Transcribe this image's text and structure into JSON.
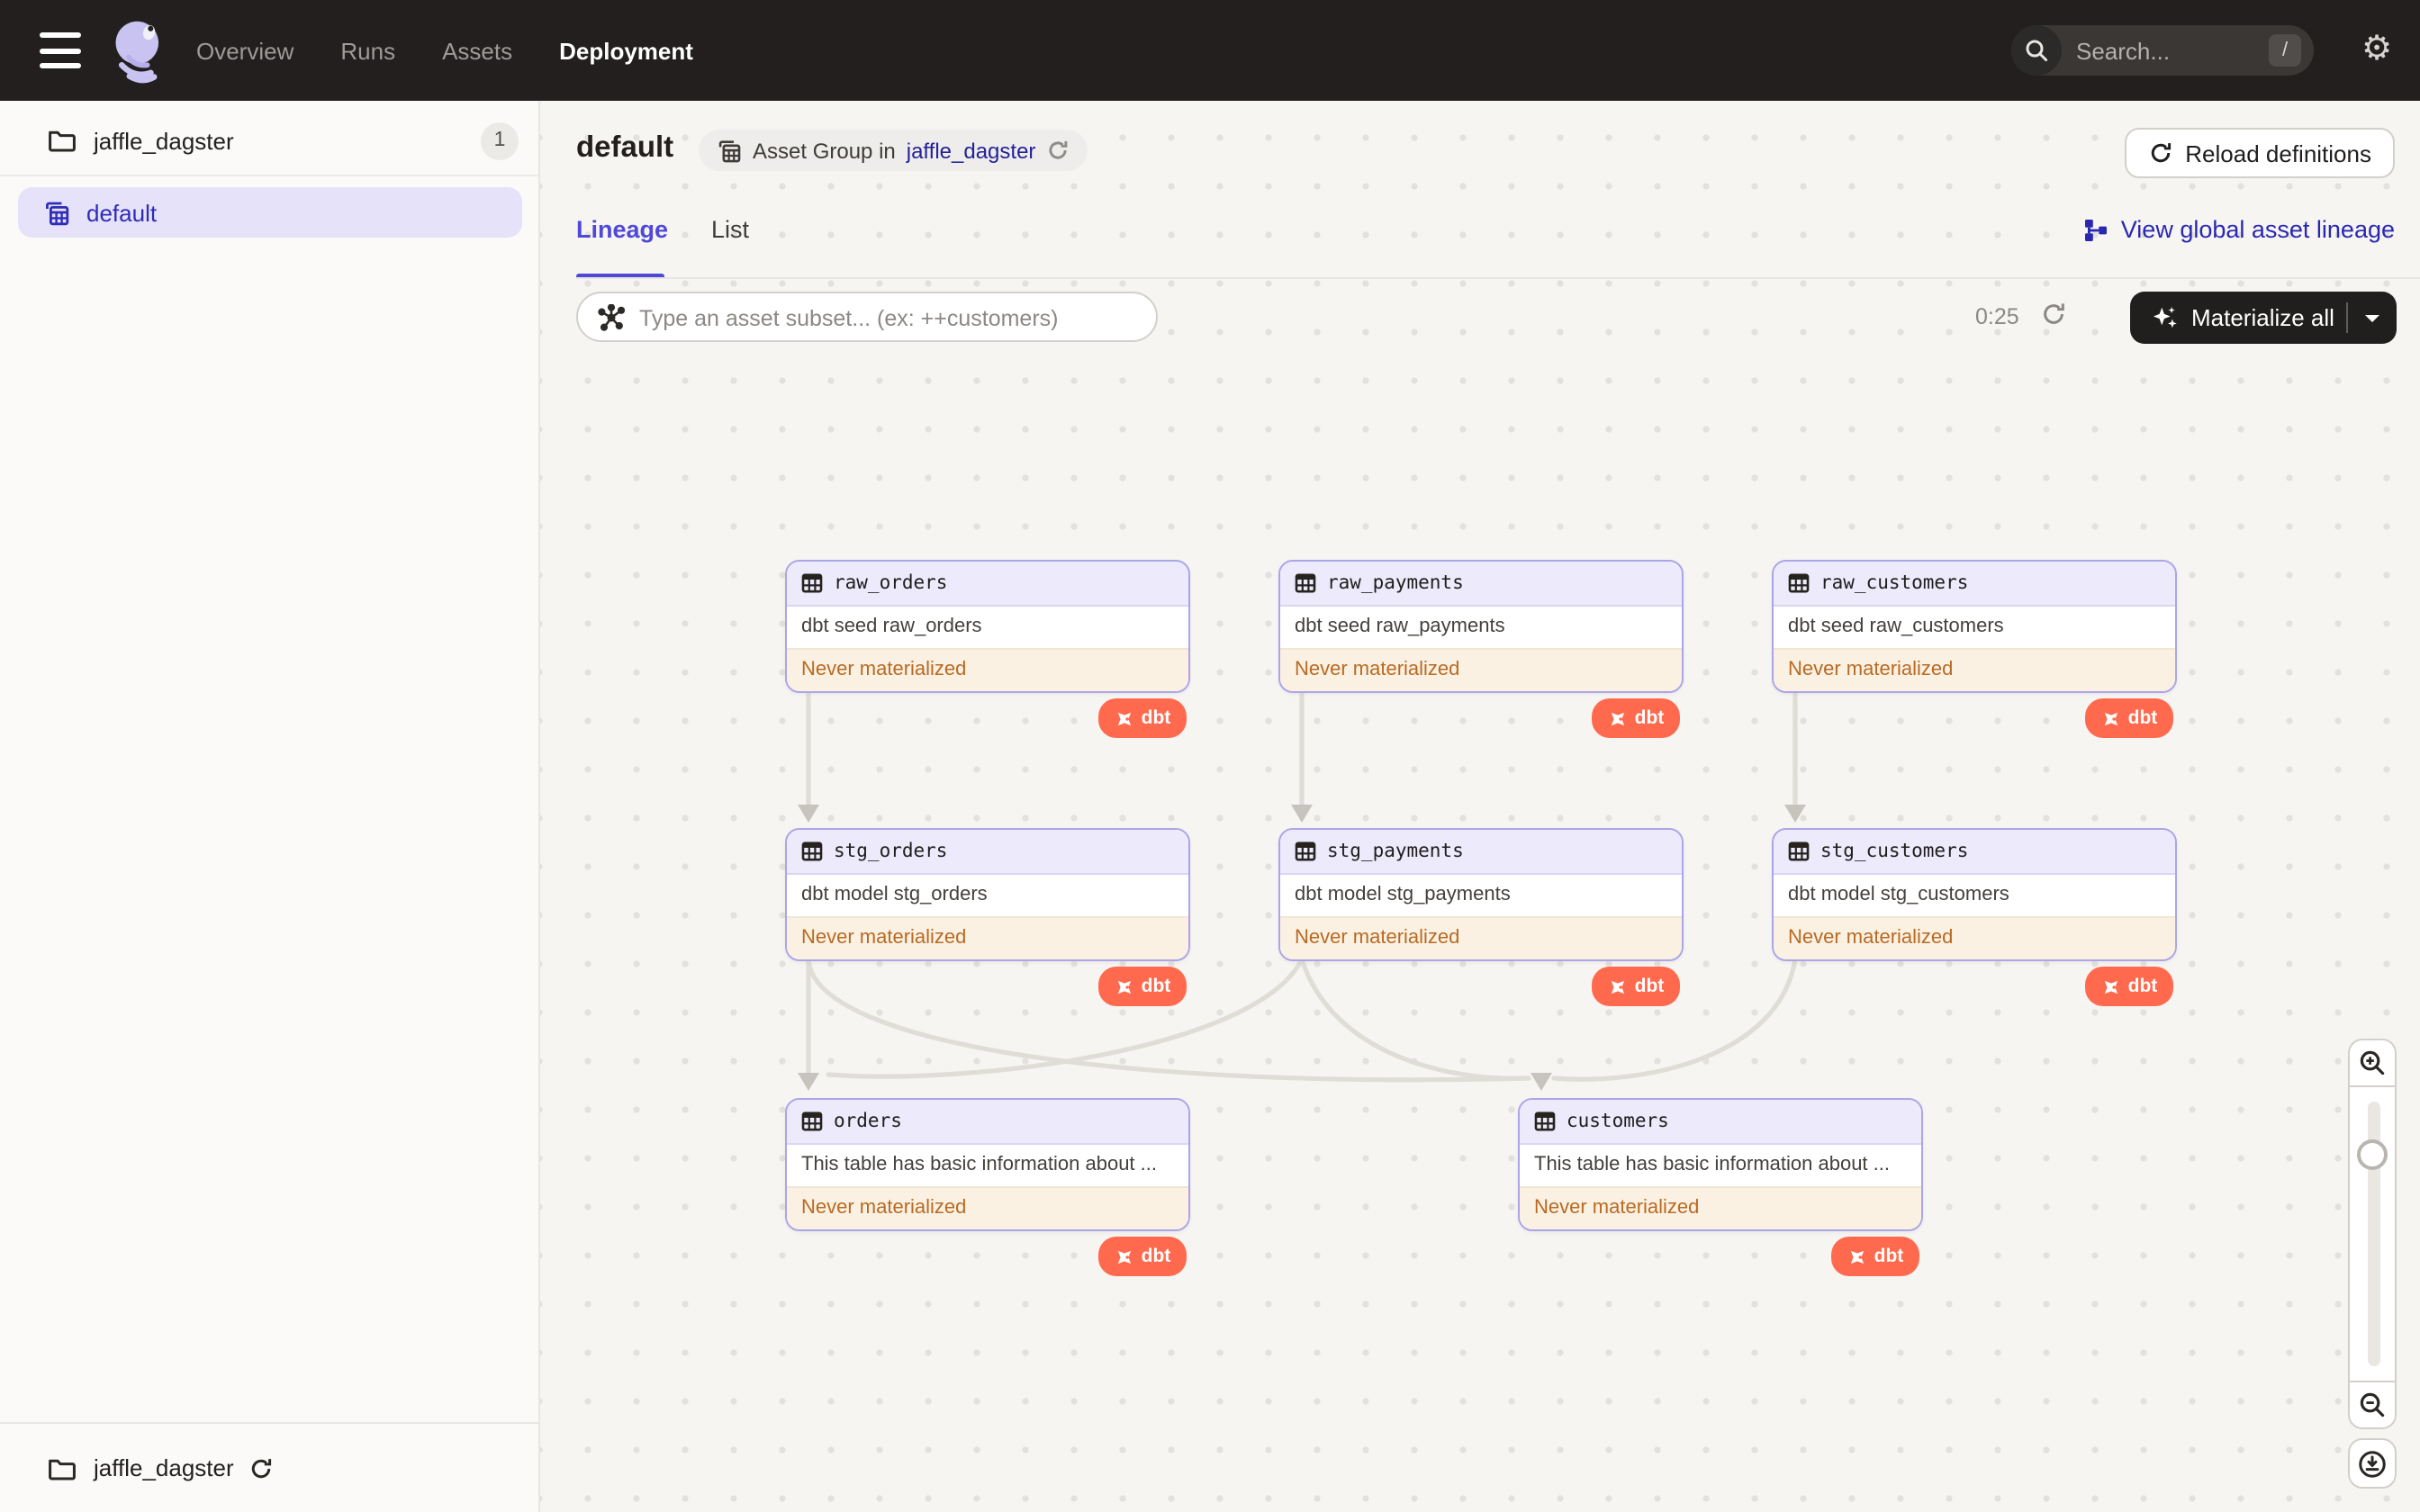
{
  "nav": {
    "items": [
      "Overview",
      "Runs",
      "Assets",
      "Deployment"
    ],
    "active_item": "Deployment",
    "search": {
      "placeholder": "Search...",
      "shortcut": "/"
    }
  },
  "sidebar": {
    "project": {
      "name": "jaffle_dagster",
      "count": "1"
    },
    "selected_group": "default",
    "footer": {
      "name": "jaffle_dagster"
    }
  },
  "header": {
    "title": "default",
    "type_label": "Asset Group in",
    "type_link": "jaffle_dagster",
    "reload_button": "Reload definitions"
  },
  "tabs": {
    "items": [
      "Lineage",
      "List"
    ],
    "active": "Lineage",
    "global_lineage_link": "View global asset lineage"
  },
  "toolbar": {
    "filter_placeholder": "Type an asset subset... (ex: ++customers)",
    "timer": "0:25",
    "materialize_button": "Materialize all"
  },
  "graph": {
    "nodes": [
      {
        "name": "raw_orders",
        "description": "dbt seed raw_orders",
        "status": "Never materialized",
        "badge": "dbt"
      },
      {
        "name": "raw_payments",
        "description": "dbt seed raw_payments",
        "status": "Never materialized",
        "badge": "dbt"
      },
      {
        "name": "raw_customers",
        "description": "dbt seed raw_customers",
        "status": "Never materialized",
        "badge": "dbt"
      },
      {
        "name": "stg_orders",
        "description": "dbt model stg_orders",
        "status": "Never materialized",
        "badge": "dbt"
      },
      {
        "name": "stg_payments",
        "description": "dbt model stg_payments",
        "status": "Never materialized",
        "badge": "dbt"
      },
      {
        "name": "stg_customers",
        "description": "dbt model stg_customers",
        "status": "Never materialized",
        "badge": "dbt"
      },
      {
        "name": "orders",
        "description": "This table has basic information about ...",
        "status": "Never materialized",
        "badge": "dbt"
      },
      {
        "name": "customers",
        "description": "This table has basic information about ...",
        "status": "Never materialized",
        "badge": "dbt"
      }
    ]
  },
  "colors": {
    "nav_bg": "#221f1e",
    "accent_indigo": "#5048d6",
    "sidebar_selected_text": "#2f2cb8",
    "link_indigo": "#2a28b0",
    "breadcrumb_link": "#232297",
    "node_border": "#aba5e7",
    "node_header_bg": "#eceafb",
    "status_bg": "#fbf1e2",
    "status_text": "#b96a23",
    "dbt_badge_bg": "#ff6a4e",
    "canvas_bg": "#f6f5f2",
    "selected_item_bg": "#e5e2fa"
  }
}
